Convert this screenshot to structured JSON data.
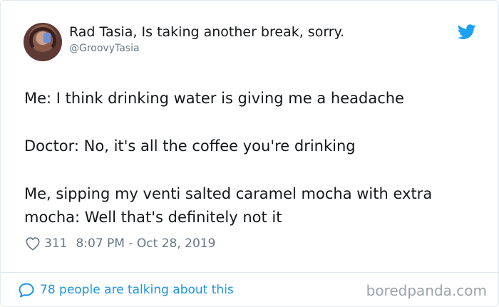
{
  "author": {
    "name": "Rad Tasia, Is taking another break, sorry.",
    "handle": "@GroovyTasia"
  },
  "icons": {
    "avatar": "avatar-photo",
    "brand": "twitter-bird-icon",
    "like": "heart-icon",
    "reply": "speech-bubble-icon"
  },
  "tweet": {
    "paragraphs": [
      "Me: I think drinking water is giving me a headache",
      "Doctor: No, it's all the coffee you're drinking",
      "Me, sipping my venti salted caramel mocha with extra mocha: Well that's definitely not it"
    ]
  },
  "meta": {
    "likes": "311",
    "timestamp": "8:07 PM - Oct 28, 2019"
  },
  "footer": {
    "talking": "78 people are talking about this",
    "watermark": "boredpanda.com"
  },
  "colors": {
    "twitter_blue": "#1da1f2",
    "link_blue": "#1b95e0",
    "secondary_text": "#657786",
    "border": "#e1e8ed"
  }
}
